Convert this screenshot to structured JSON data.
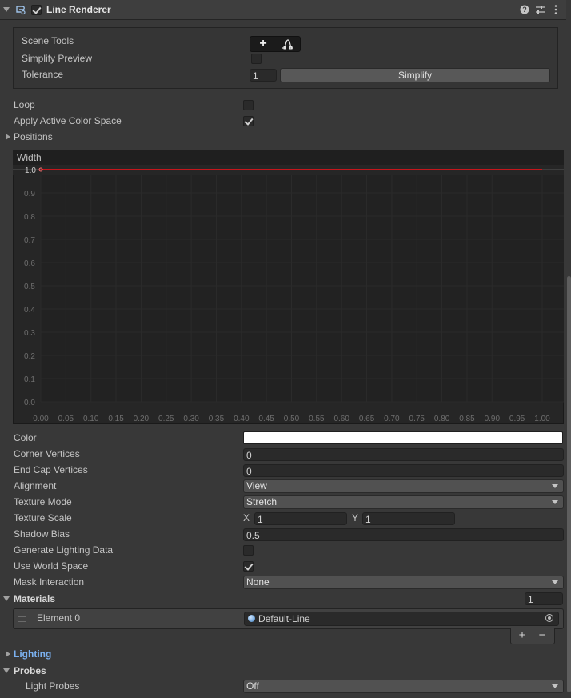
{
  "header": {
    "title": "Line Renderer",
    "enabled": true
  },
  "scene_tools": {
    "label": "Scene Tools",
    "add_glyph": "+",
    "simplify_preview_label": "Simplify Preview",
    "tolerance_label": "Tolerance",
    "tolerance_value": "1",
    "simplify_button": "Simplify"
  },
  "loop_label": "Loop",
  "apply_color_space_label": "Apply Active Color Space",
  "positions_label": "Positions",
  "width_curve": {
    "title": "Width",
    "y_ticks": [
      "1.0",
      "0.9",
      "0.8",
      "0.7",
      "0.6",
      "0.5",
      "0.4",
      "0.3",
      "0.2",
      "0.1",
      "0.0"
    ],
    "x_ticks": [
      "0.00",
      "0.05",
      "0.10",
      "0.15",
      "0.20",
      "0.25",
      "0.30",
      "0.35",
      "0.40",
      "0.45",
      "0.50",
      "0.55",
      "0.60",
      "0.65",
      "0.70",
      "0.75",
      "0.80",
      "0.85",
      "0.90",
      "0.95",
      "1.00"
    ],
    "line_color": "#c4161c",
    "curve_points": [
      [
        0,
        1.0
      ],
      [
        1,
        1.0
      ]
    ]
  },
  "props": {
    "color_label": "Color",
    "color_value": "#ffffff",
    "corner_vertices_label": "Corner Vertices",
    "corner_vertices_value": "0",
    "end_cap_vertices_label": "End Cap Vertices",
    "end_cap_vertices_value": "0",
    "alignment_label": "Alignment",
    "alignment_value": "View",
    "texture_mode_label": "Texture Mode",
    "texture_mode_value": "Stretch",
    "texture_scale_label": "Texture Scale",
    "texture_scale_x_label": "X",
    "texture_scale_x": "1",
    "texture_scale_y_label": "Y",
    "texture_scale_y": "1",
    "shadow_bias_label": "Shadow Bias",
    "shadow_bias_value": "0.5",
    "generate_lighting_label": "Generate Lighting Data",
    "use_world_space_label": "Use World Space",
    "mask_interaction_label": "Mask Interaction",
    "mask_interaction_value": "None"
  },
  "materials": {
    "label": "Materials",
    "count": "1",
    "element_label": "Element 0",
    "element_value": "Default-Line",
    "add_glyph": "+",
    "remove_glyph": "−"
  },
  "lighting_label": "Lighting",
  "probes_label": "Probes",
  "light_probes_label": "Light Probes",
  "light_probes_value": "Off"
}
